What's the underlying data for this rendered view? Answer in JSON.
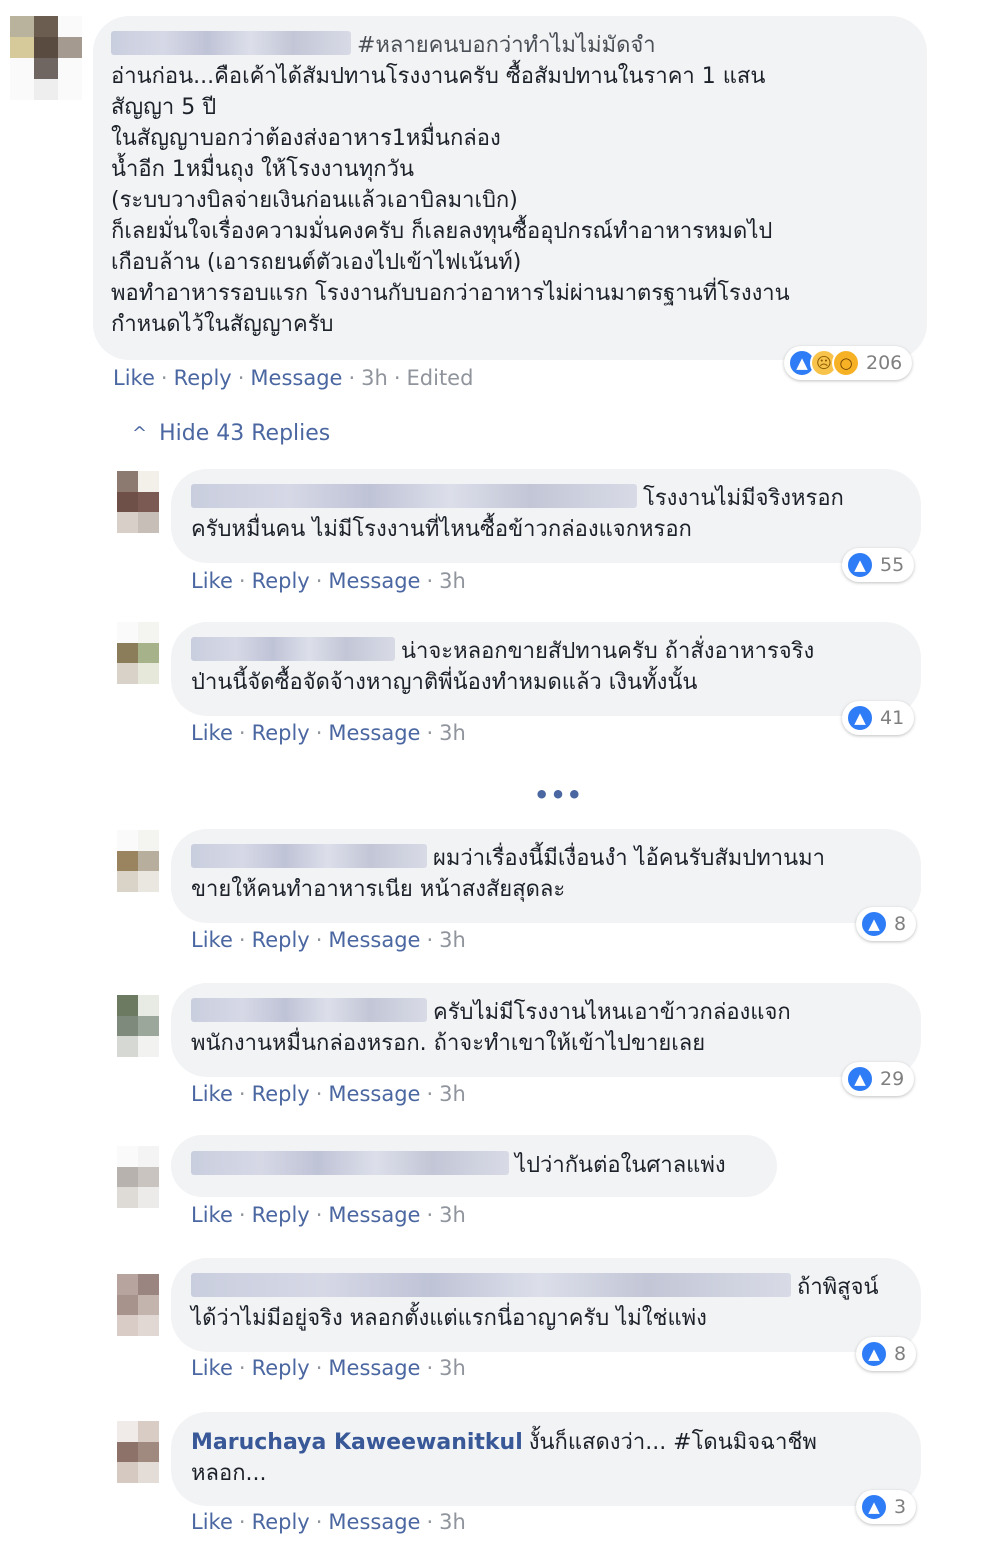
{
  "main_comment": {
    "hashtag": "#หลายคนบอกว่าทำไมไม่มัดจำ",
    "lines": [
      "อ่านก่อน...คือเค้าได้สัมปทานโรงงานครับ ซื้อสัมปทานในราคา 1 แสน",
      "สัญญา 5 ปี",
      "ในสัญญาบอกว่าต้องส่งอาหาร1หมื่นกล่อง",
      "น้ำอีก 1หมื่นถุง ให้โรงงานทุกวัน",
      "(ระบบวางบิลจ่ายเงินก่อนแล้วเอาบิลมาเบิก)",
      "ก็เลยมั่นใจเรื่องความมั่นคงครับ ก็เลยลงทุนซื้ออุปกรณ์ทำอาหารหมดไป",
      "เกือบล้าน (เอารถยนต์ตัวเองไปเข้าไฟเน้นท์)",
      "พอทำอาหารรอบแรก โรงงานกับบอกว่าอาหารไม่ผ่านมาตรฐานที่โรงงาน",
      "กำหนดไว้ในสัญญาครับ"
    ],
    "reaction_count": "206",
    "actions": {
      "like": "Like",
      "reply": "Reply",
      "message": "Message",
      "time": "3h",
      "edited": "Edited"
    }
  },
  "hide_replies_label": "Hide 43 Replies",
  "more_indicator": "•••",
  "reply_actions": {
    "like": "Like",
    "reply": "Reply",
    "message": "Message",
    "time": "3h"
  },
  "replies": [
    {
      "line1": "โรงงานไม่มีจริงหรอก",
      "line2": "ครับหมื่นคน ไม่มีโรงงานที่ไหนซื้อข้าวกล่องแจกหรอก",
      "likes": "55"
    },
    {
      "line1": "น่าจะหลอกขายสัปทานครับ ถ้าสั่งอาหารจริง",
      "line2": "ป่านนี้จัดซื้อจัดจ้างหาญาติพี่น้องทำหมดแล้ว เงินทั้งนั้น",
      "likes": "41"
    },
    {
      "line1": "ผมว่าเรื่องนี้มีเงื่อนงำ ไอ้คนรับสัมปทานมา",
      "line2": "ขายให้คนทำอาหารเนีย หน้าสงสัยสุดละ",
      "likes": "8"
    },
    {
      "line1": "ครับไม่มีโรงงานไหนเอาข้าวกล่องแจก",
      "line2": "พนักงานหมื่นกล่องหรอก. ถ้าจะทำเขาให้เข้าไปขายเลย",
      "likes": "29"
    },
    {
      "line1": "ไปว่ากันต่อในศาลแพ่ง",
      "line2": "",
      "likes": ""
    },
    {
      "line1": "ถ้าพิสูจน์",
      "line2": "ได้ว่าไม่มีอยู่จริง หลอกตั้งแต่แรกนี่อาญาครับ ไม่ใช่แพ่ง",
      "likes": "8"
    },
    {
      "author": "Maruchaya Kaweewanitkul",
      "line1": "งั้นก็แสดงว่า... #โดนมิจฉาชีพ",
      "line2": "หลอก...",
      "likes": "3"
    }
  ],
  "colors": {
    "link": "#4b67a1",
    "author": "#385898",
    "meta": "#90949c",
    "bubble": "#f2f3f5",
    "like_blue": "#2e7cf6"
  }
}
